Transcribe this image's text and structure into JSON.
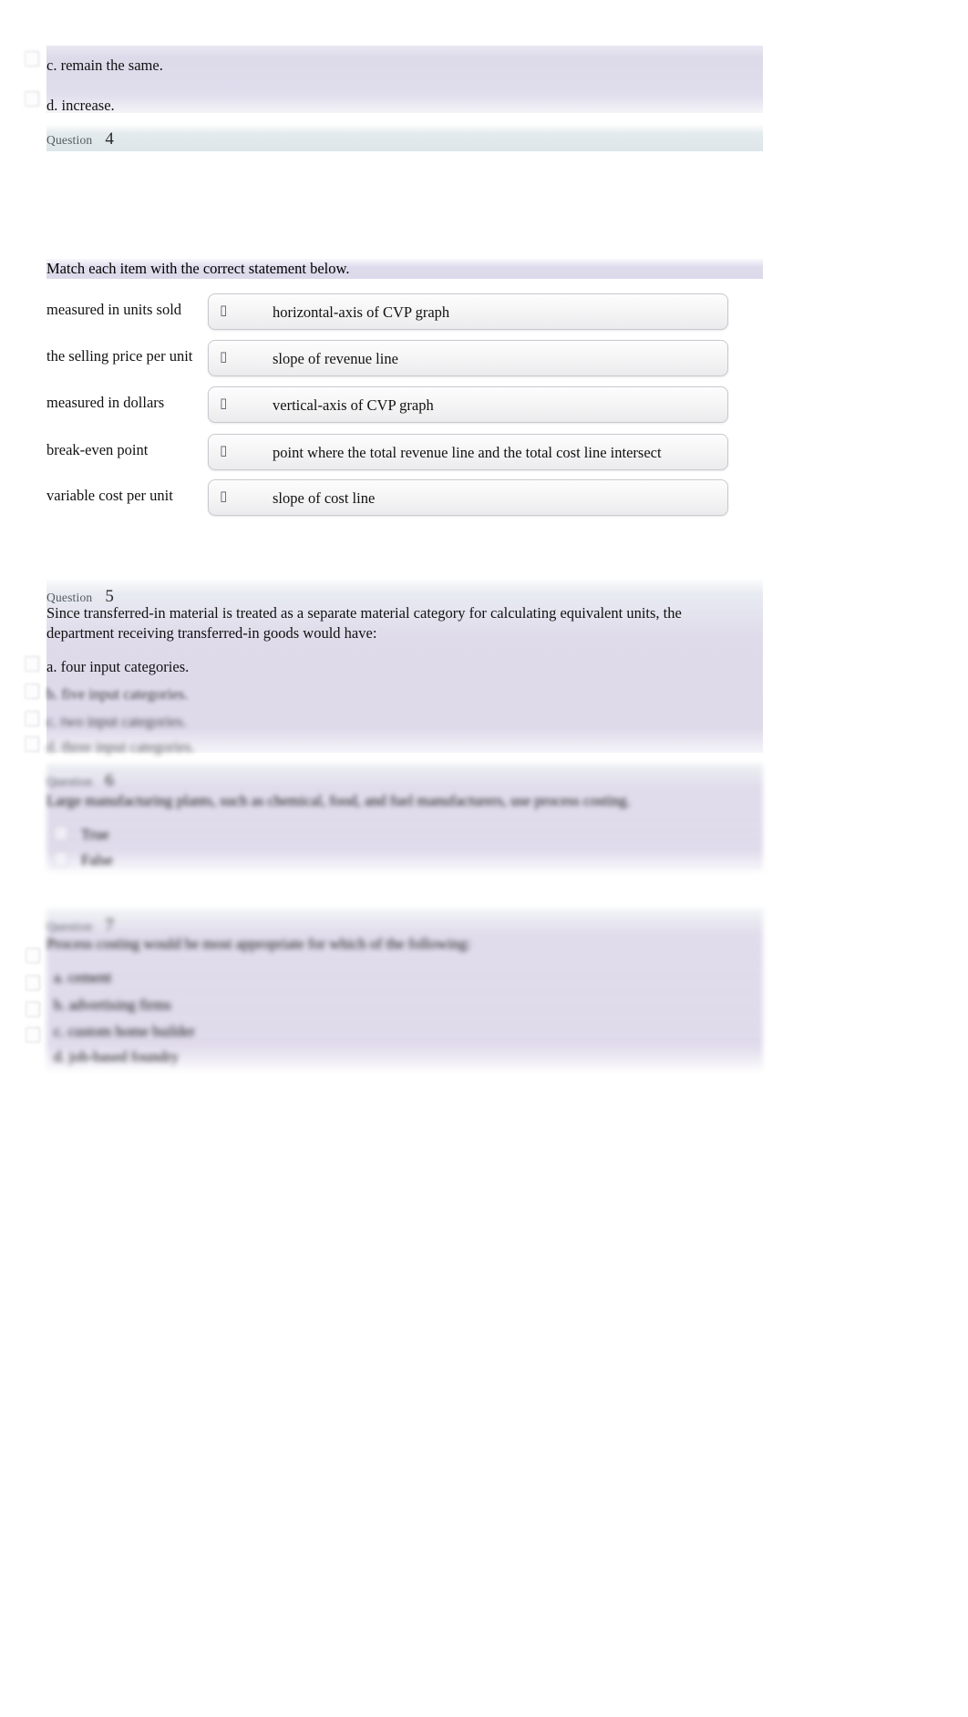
{
  "document": {
    "page_background": "#ffffff",
    "band_purple": "#dbd8e9",
    "band_blue": "#dbe4e8"
  },
  "question3_tail": {
    "option_c": "c. remain the same.",
    "option_d": "d. increase."
  },
  "question4": {
    "label": "Question",
    "number": "4",
    "instruction": "Match each item with the correct statement below.",
    "caret_glyph": "▯",
    "rows": [
      {
        "prompt": "measured in units sold",
        "selected": "horizontal-axis of CVP graph"
      },
      {
        "prompt": "the selling price per unit",
        "selected": "slope of revenue line"
      },
      {
        "prompt": "measured in dollars",
        "selected": "vertical-axis of CVP graph"
      },
      {
        "prompt": "break-even point",
        "selected": "point where the total revenue line and the total cost line intersect"
      },
      {
        "prompt": "variable cost per unit",
        "selected": "slope of cost line"
      }
    ]
  },
  "question5": {
    "label": "Question",
    "number": "5",
    "stem": "Since transferred-in material is treated as a separate material category for calculating equivalent units, the department receiving transferred-in goods would have:",
    "options": [
      "a.  four input categories.",
      "b.  five input categories.",
      "c.  two input categories.",
      "d.  three input categories."
    ]
  },
  "question6": {
    "label": "Question",
    "number": "6",
    "stem": "Large manufacturing plants, such as chemical, food, and fuel manufacturers, use process costing.",
    "options": [
      "True",
      "False"
    ]
  },
  "question7": {
    "label": "Question",
    "number": "7",
    "stem": "Process costing would be most appropriate for which of the following:",
    "options": [
      "a.  cement",
      "b.  advertising firms",
      "c.  custom home builder",
      "d.  job-based foundry"
    ]
  }
}
